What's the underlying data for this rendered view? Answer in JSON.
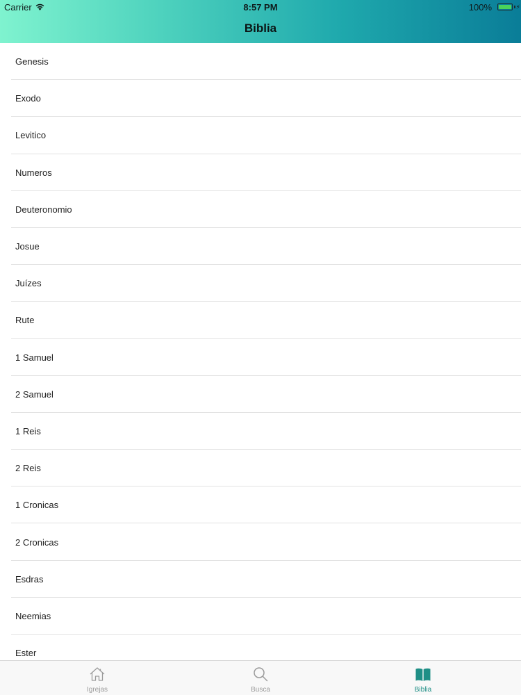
{
  "status_bar": {
    "carrier": "Carrier",
    "time": "8:57 PM",
    "battery": "100%"
  },
  "nav": {
    "title": "Biblia"
  },
  "books": [
    "Genesis",
    "Exodo",
    "Levitico",
    "Numeros",
    "Deuteronomio",
    "Josue",
    "Juízes",
    "Rute",
    "1 Samuel",
    "2 Samuel",
    "1 Reis",
    "2 Reis",
    "1 Cronicas",
    "2 Cronicas",
    "Esdras",
    "Neemias",
    "Ester"
  ],
  "tabs": [
    {
      "label": "Igrejas",
      "icon": "home-icon",
      "active": false
    },
    {
      "label": "Busca",
      "icon": "search-icon",
      "active": false
    },
    {
      "label": "Biblia",
      "icon": "book-icon",
      "active": true
    }
  ],
  "colors": {
    "header_gradient_start": "#7ff3cf",
    "header_gradient_end": "#0a7d98",
    "accent": "#1f8f86",
    "battery": "#49d35a"
  }
}
